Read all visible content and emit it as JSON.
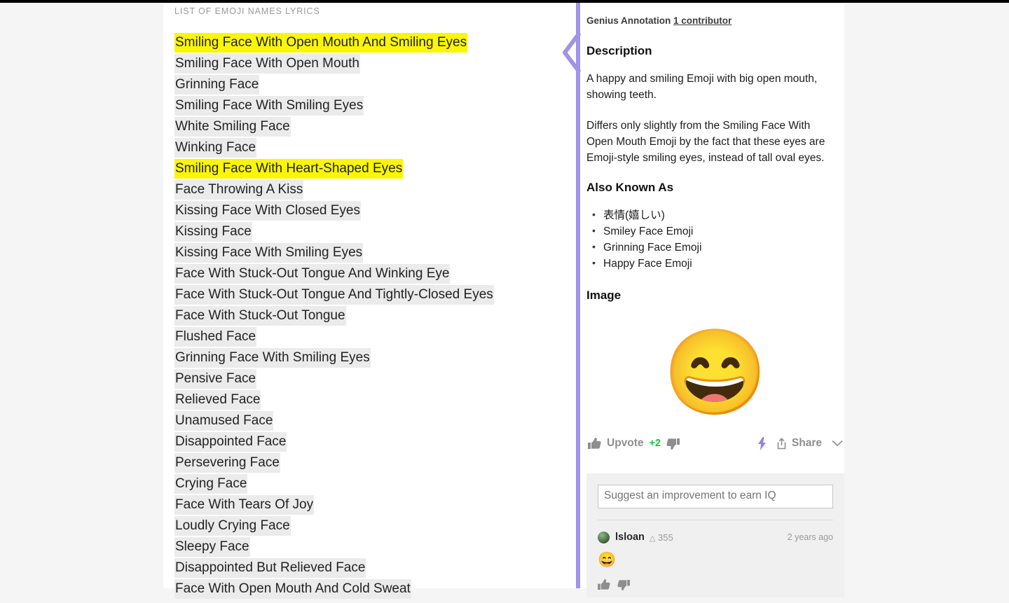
{
  "colors": {
    "page_bg": "#f5f5f5",
    "panel_bg": "#ffffff",
    "highlight_yellow": "#fbf604",
    "lyric_gray": "#ebebeb",
    "bracket_purple": "#a093e8",
    "upvote_green": "#19c337",
    "comment_bg": "#f0f0f0"
  },
  "lyrics": {
    "header": "LIST OF EMOJI NAMES LYRICS",
    "lines": [
      {
        "text": "Smiling Face With Open Mouth And Smiling Eyes",
        "highlighted": true
      },
      {
        "text": "Smiling Face With Open Mouth",
        "highlighted": false
      },
      {
        "text": "Grinning Face",
        "highlighted": false
      },
      {
        "text": "Smiling Face With Smiling Eyes",
        "highlighted": false
      },
      {
        "text": "White Smiling Face",
        "highlighted": false
      },
      {
        "text": "Winking Face",
        "highlighted": false
      },
      {
        "text": "Smiling Face With Heart-Shaped Eyes",
        "highlighted": true
      },
      {
        "text": "Face Throwing A Kiss",
        "highlighted": false
      },
      {
        "text": "Kissing Face With Closed Eyes",
        "highlighted": false
      },
      {
        "text": "Kissing Face",
        "highlighted": false
      },
      {
        "text": "Kissing Face With Smiling Eyes",
        "highlighted": false
      },
      {
        "text": "Face With Stuck-Out Tongue And Winking Eye",
        "highlighted": false
      },
      {
        "text": "Face With Stuck-Out Tongue And Tightly-Closed Eyes",
        "highlighted": false
      },
      {
        "text": "Face With Stuck-Out Tongue",
        "highlighted": false
      },
      {
        "text": "Flushed Face",
        "highlighted": false
      },
      {
        "text": "Grinning Face With Smiling Eyes",
        "highlighted": false
      },
      {
        "text": "Pensive Face",
        "highlighted": false
      },
      {
        "text": "Relieved Face",
        "highlighted": false
      },
      {
        "text": "Unamused Face",
        "highlighted": false
      },
      {
        "text": "Disappointed Face",
        "highlighted": false
      },
      {
        "text": "Persevering Face",
        "highlighted": false
      },
      {
        "text": "Crying Face",
        "highlighted": false
      },
      {
        "text": "Face With Tears Of Joy",
        "highlighted": false
      },
      {
        "text": "Loudly Crying Face",
        "highlighted": false
      },
      {
        "text": "Sleepy Face",
        "highlighted": false
      },
      {
        "text": "Disappointed But Relieved Face",
        "highlighted": false
      },
      {
        "text": "Face With Open Mouth And Cold Sweat",
        "highlighted": false
      }
    ]
  },
  "annotation": {
    "meta_prefix": "Genius Annotation ",
    "contributor_link": "1 contributor",
    "description_heading": "Description",
    "description_p1": "A happy and smiling Emoji with big open mouth, showing teeth.",
    "description_p2": "Differs only slightly from the Smiling Face With Open Mouth Emoji by the fact that these eyes are Emoji-style smiling eyes, instead of tall oval eyes.",
    "aka_heading": "Also Known As",
    "aka_items": [
      "表情(嬉しい)",
      "Smiley Face Emoji",
      "Grinning Face Emoji",
      "Happy Face Emoji"
    ],
    "image_heading": "Image",
    "image_emoji": "😄"
  },
  "vote_row": {
    "upvote_label": "Upvote",
    "count": "+2",
    "share_label": "Share"
  },
  "comment_section": {
    "suggest_placeholder": "Suggest an improvement to earn IQ",
    "comment": {
      "username": "lsloan",
      "iq_symbol": "△",
      "iq_value": "355",
      "timestamp": "2 years ago",
      "body": "😄"
    }
  }
}
